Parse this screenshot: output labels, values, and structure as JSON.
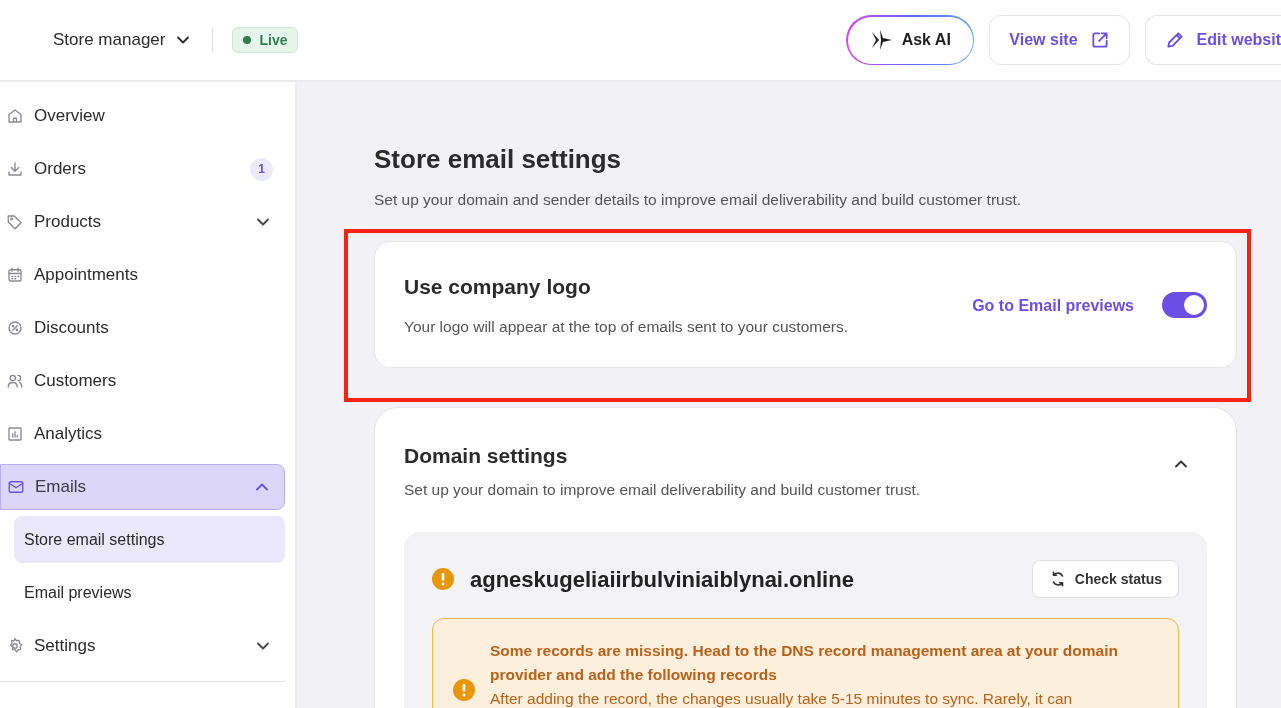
{
  "header": {
    "store_switcher": "Store manager",
    "status_badge": {
      "label": "Live",
      "color": "#2e7d4f"
    },
    "buttons": [
      {
        "kind": "ai",
        "label": "Ask AI"
      },
      {
        "kind": "view",
        "label": "View site"
      },
      {
        "kind": "edit",
        "label": "Edit websit"
      }
    ]
  },
  "sidebar": {
    "items": [
      {
        "label": "Overview",
        "selected": false
      },
      {
        "label": "Orders",
        "selected": false,
        "count": "1"
      },
      {
        "label": "Products",
        "selected": false,
        "expanded": false
      },
      {
        "label": "Appointments",
        "selected": false
      },
      {
        "label": "Discounts",
        "selected": false
      },
      {
        "label": "Customers",
        "selected": false
      },
      {
        "label": "Analytics",
        "selected": false
      },
      {
        "label": "Emails",
        "selected": true,
        "expanded": true,
        "children": [
          {
            "label": "Store email settings",
            "selected": true
          },
          {
            "label": "Email previews",
            "selected": false
          }
        ]
      },
      {
        "label": "Settings",
        "selected": false,
        "expanded": false
      }
    ]
  },
  "page": {
    "title": "Store email settings",
    "subtitle": "Set up your domain and sender details to improve email deliverability and build customer trust.",
    "logo_card": {
      "title": "Use company logo",
      "description": "Your logo will appear at the top of emails sent to your customers.",
      "link": "Go to Email previews",
      "toggle_on": true
    },
    "domain_card": {
      "title": "Domain settings",
      "description": "Set up your domain to improve email deliverability and build customer trust.",
      "expanded": true,
      "domain": {
        "name": "agneskugeliaiirbulviniaiblynai.online",
        "check_button": "Check status",
        "warning": {
          "title": "Some records are missing. Head to the DNS record management area at your domain provider and add the following records",
          "body": "After adding the record, the changes usually take 5-15 minutes to sync. Rarely, it can"
        }
      }
    }
  }
}
